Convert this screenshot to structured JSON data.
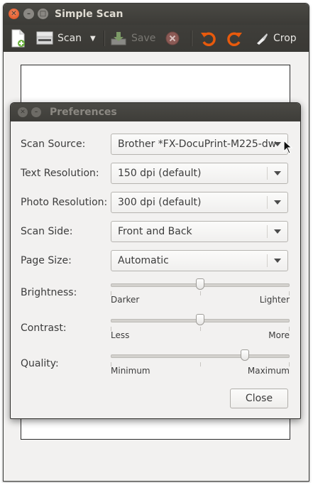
{
  "window": {
    "title": "Simple Scan",
    "controls": [
      "close",
      "minimize",
      "maximize"
    ]
  },
  "toolbar": {
    "new_icon": "new-document-icon",
    "scan_label": "Scan",
    "save_label": "Save",
    "crop_label": "Crop",
    "items": [
      "new",
      "scan",
      "scan-options",
      "save",
      "stop",
      "rotate-left",
      "rotate-right",
      "crop"
    ]
  },
  "preferences": {
    "title": "Preferences",
    "scan_source": {
      "label": "Scan Source:",
      "value": "Brother *FX-DocuPrint-M225-dw"
    },
    "text_resolution": {
      "label": "Text Resolution:",
      "value": "150 dpi (default)"
    },
    "photo_resolution": {
      "label": "Photo Resolution:",
      "value": "300 dpi (default)"
    },
    "scan_side": {
      "label": "Scan Side:",
      "value": "Front and Back"
    },
    "page_size": {
      "label": "Page Size:",
      "value": "Automatic"
    },
    "brightness": {
      "label": "Brightness:",
      "min_label": "Darker",
      "max_label": "Lighter",
      "level": 0.5
    },
    "contrast": {
      "label": "Contrast:",
      "min_label": "Less",
      "max_label": "More",
      "level": 0.5
    },
    "quality": {
      "label": "Quality:",
      "min_label": "Minimum",
      "max_label": "Maximum",
      "level": 0.75
    },
    "close_label": "Close"
  },
  "colors": {
    "titlebar": "#3c3b37",
    "close_button": "#df4a16",
    "rotate_icon": "#e85a0c",
    "dialog_bg": "#f2f1f0"
  }
}
